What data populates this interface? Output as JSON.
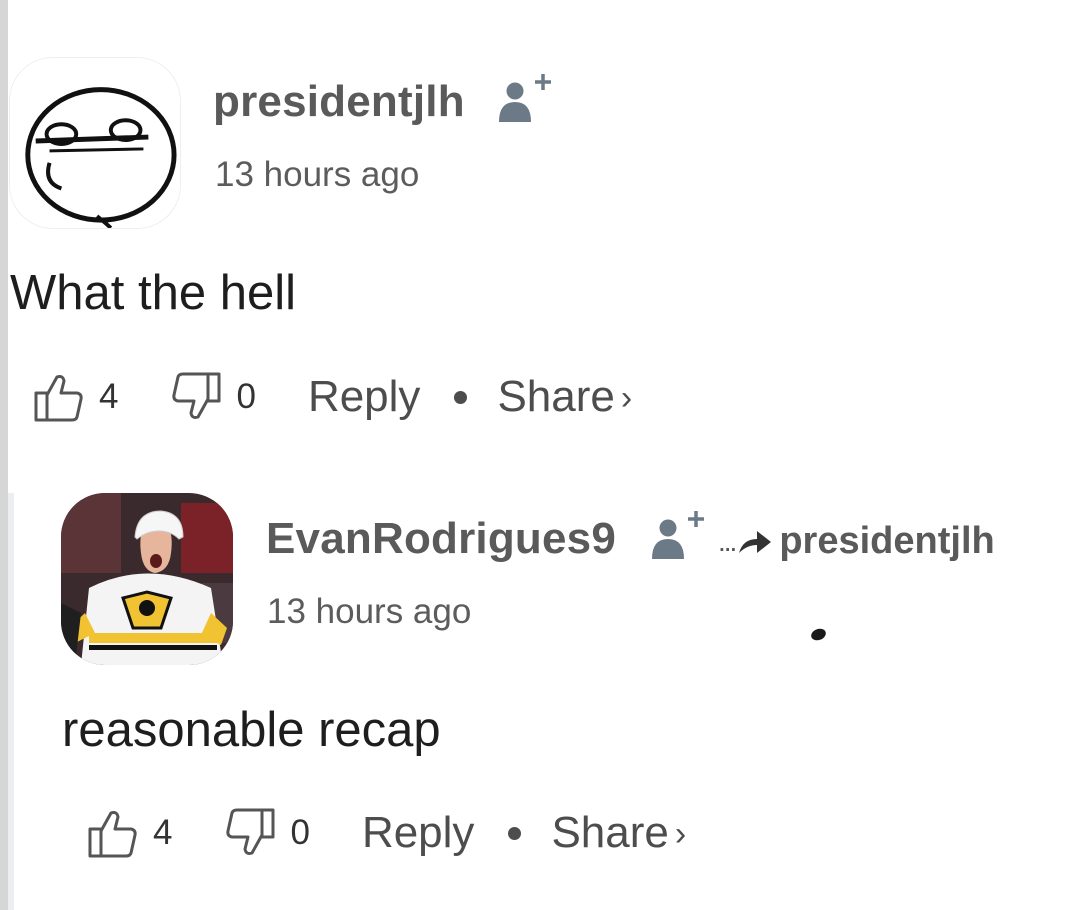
{
  "comments": [
    {
      "username": "presidentjlh",
      "timestamp": "13 hours ago",
      "body": "What the hell",
      "likes": "4",
      "dislikes": "0",
      "reply_label": "Reply",
      "share_label": "Share",
      "avatar_icon": "meme-face-avatar"
    },
    {
      "username": "EvanRodrigues9",
      "timestamp": "13 hours ago",
      "body": "reasonable recap",
      "likes": "4",
      "dislikes": "0",
      "reply_label": "Reply",
      "share_label": "Share",
      "reply_to": "presidentjlh",
      "reply_to_prefix": "...",
      "avatar_icon": "hockey-player-avatar"
    }
  ],
  "icons": {
    "follow": "add-user-icon",
    "like": "thumbs-up-icon",
    "dislike": "thumbs-down-icon",
    "reply_arrow": "reply-arrow-icon"
  },
  "colors": {
    "username": "#5a5a5a",
    "text": "#1e1e1e",
    "icon": "#6b7a86"
  }
}
